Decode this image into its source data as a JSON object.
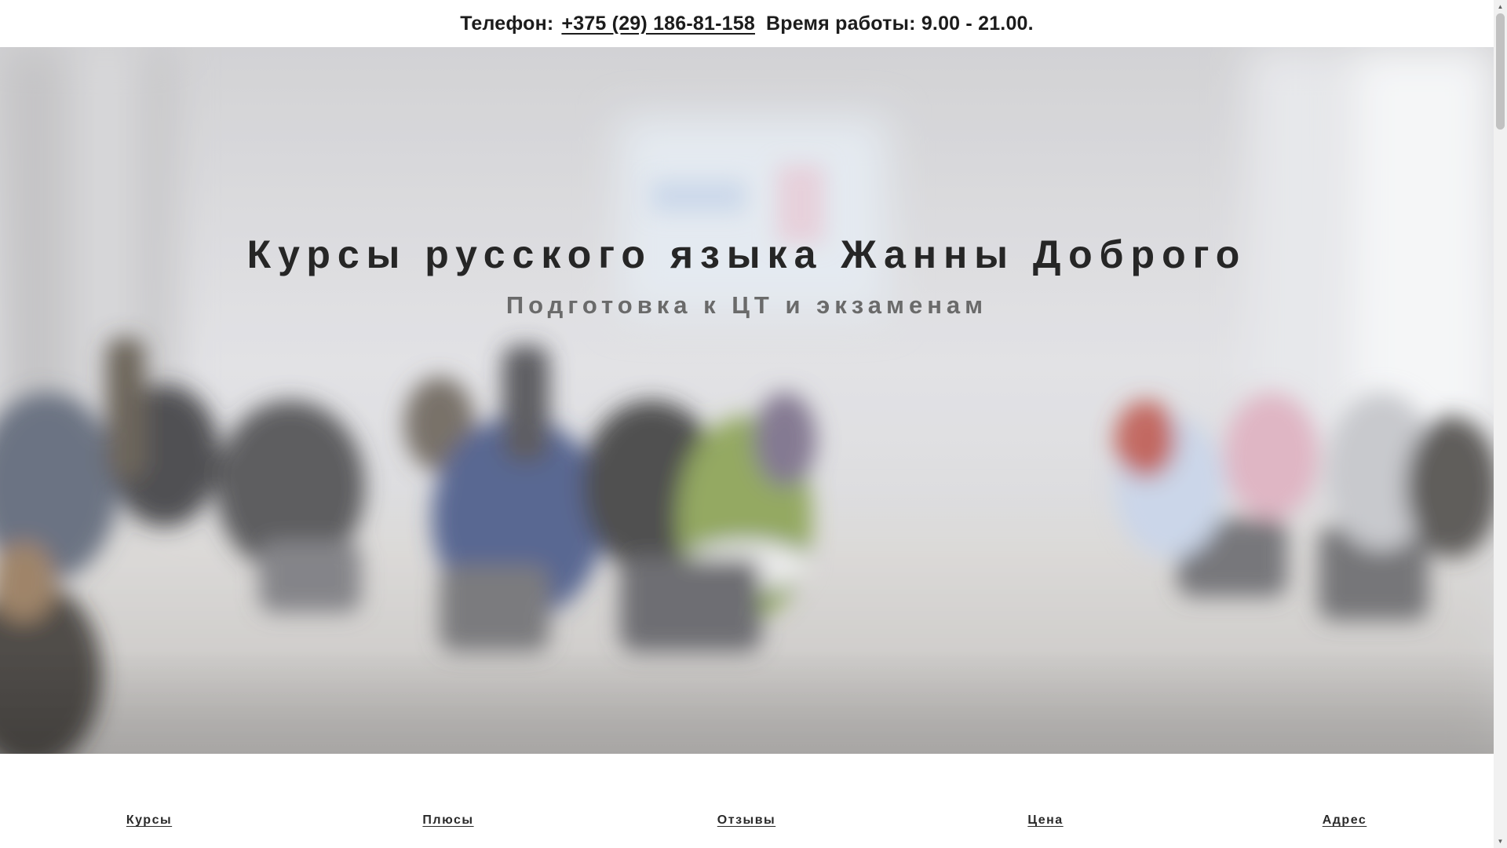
{
  "topbar": {
    "phone_label": "Телефон:",
    "phone_number": "+375 (29) 186-81-158",
    "hours": "Время работы: 9.00 - 21.00."
  },
  "hero": {
    "title": "Курсы русского языка Жанны Доброго",
    "subtitle": "Подготовка к ЦТ и экзаменам"
  },
  "nav": {
    "items": [
      {
        "label": "Курсы"
      },
      {
        "label": "Плюсы"
      },
      {
        "label": "Отзывы"
      },
      {
        "label": "Цена"
      },
      {
        "label": "Адрес"
      }
    ]
  },
  "scrollbar": {
    "up_icon": "scroll-up-arrow-icon",
    "down_icon": "scroll-down-arrow-icon"
  }
}
